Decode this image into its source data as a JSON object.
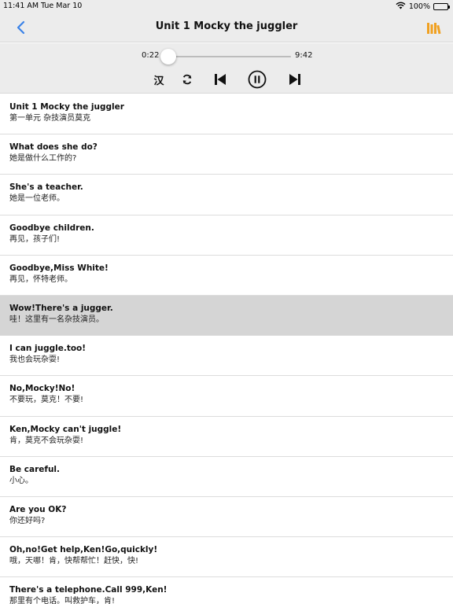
{
  "statusbar": {
    "time": "11:41 AM",
    "date": "Tue Mar 10",
    "battery": "100%"
  },
  "nav": {
    "title": "Unit 1  Mocky the juggler",
    "accent": "#3a82e8",
    "library_color": "#f0a020"
  },
  "player": {
    "current": "0:22",
    "total": "9:42",
    "progress": 0.038,
    "han_label": "汉"
  },
  "active_index": 5,
  "lines": [
    {
      "en": "Unit 1 Mocky the juggler",
      "zh": "第一单元 杂技演员莫克"
    },
    {
      "en": "What does she do?",
      "zh": "她是做什么工作的?"
    },
    {
      "en": "She's a teacher.",
      "zh": "她是一位老师。"
    },
    {
      "en": "Goodbye children.",
      "zh": "再见，孩子们!"
    },
    {
      "en": "Goodbye,Miss White!",
      "zh": "再见，怀特老师。"
    },
    {
      "en": "Wow!There's a jugger.",
      "zh": "哇！这里有一名杂技演员。"
    },
    {
      "en": "I can juggle.too!",
      "zh": "我也会玩杂耍!"
    },
    {
      "en": "No,Mocky!No!",
      "zh": "不要玩，莫克！不要!"
    },
    {
      "en": "Ken,Mocky can't juggle!",
      "zh": "肯，莫克不会玩杂耍!"
    },
    {
      "en": "Be careful.",
      "zh": "小心。"
    },
    {
      "en": "Are you OK?",
      "zh": "你还好吗?"
    },
    {
      "en": "Oh,no!Get help,Ken!Go,quickly!",
      "zh": "哦，天哪！肯，快帮帮忙！赶快，快!"
    },
    {
      "en": "There's a telephone.Call 999,Ken!",
      "zh": "那里有个电话。叫救护车，肯!"
    }
  ]
}
